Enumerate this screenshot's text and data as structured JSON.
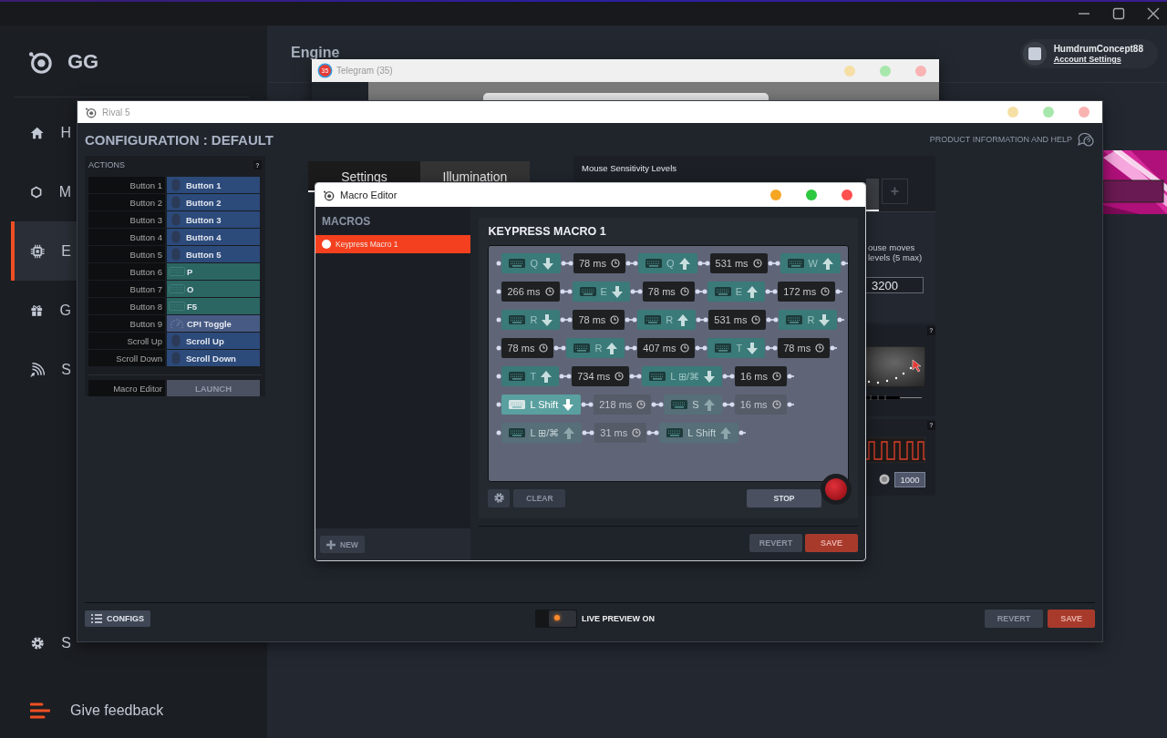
{
  "app": {
    "logo_text": "GG",
    "page_title": "Engine",
    "nav": [
      {
        "label": "H",
        "selected": false
      },
      {
        "label": "M",
        "selected": false
      },
      {
        "label": "E",
        "selected": true
      },
      {
        "label": "G",
        "selected": false
      },
      {
        "label": "S",
        "selected": false
      }
    ],
    "settings": {
      "label": "S"
    },
    "feedback": {
      "label": "Give feedback"
    },
    "account": {
      "username": "HumdrumConcept88",
      "link": "Account Settings"
    }
  },
  "telegram_window": {
    "title": "Telegram (35)",
    "badge": "35",
    "active": false
  },
  "rival_window": {
    "title": "Rival 5",
    "active": false,
    "heading": "CONFIGURATION : DEFAULT",
    "help_link": "PRODUCT INFORMATION AND HELP",
    "actions": {
      "title": "ACTIONS",
      "help": "?",
      "rows": [
        {
          "button": "Button 1",
          "action": "Button 1",
          "kind": "mouse"
        },
        {
          "button": "Button 2",
          "action": "Button 2",
          "kind": "mouse"
        },
        {
          "button": "Button 3",
          "action": "Button 3",
          "kind": "mouse"
        },
        {
          "button": "Button 4",
          "action": "Button 4",
          "kind": "mouse"
        },
        {
          "button": "Button 5",
          "action": "Button 5",
          "kind": "mouse"
        },
        {
          "button": "Button 6",
          "action": "P",
          "kind": "keyboard"
        },
        {
          "button": "Button 7",
          "action": "O",
          "kind": "keyboard"
        },
        {
          "button": "Button 8",
          "action": "F5",
          "kind": "keyboard"
        },
        {
          "button": "Button 9",
          "action": "CPI Toggle",
          "kind": "cpi"
        },
        {
          "button": "Scroll Up",
          "action": "Scroll Up",
          "kind": "mouse"
        },
        {
          "button": "Scroll Down",
          "action": "Scroll Down",
          "kind": "mouse"
        }
      ],
      "macro_editor": {
        "label": "Macro Editor",
        "button": "LAUNCH"
      }
    },
    "tabs": [
      {
        "label": "Settings",
        "selected": true
      },
      {
        "label": "Illumination",
        "selected": false
      }
    ],
    "sensitivity": {
      "title": "Mouse Sensitivity Levels",
      "add": "+",
      "note_lines": [
        "ouse moves",
        "levels (5 max)"
      ],
      "value": "3200"
    },
    "acceleration": {
      "help": "?"
    },
    "polling": {
      "help": "?",
      "value": "1000"
    },
    "footer": {
      "configs": "CONFIGS",
      "live_preview": {
        "label": "LIVE PREVIEW ON",
        "on": true
      },
      "revert": "REVERT",
      "save": "SAVE"
    }
  },
  "macro_window": {
    "title": "Macro Editor",
    "active": true,
    "list_title": "MACROS",
    "macros": [
      {
        "name": "Keypress Macro 1",
        "selected": true
      }
    ],
    "new": "NEW",
    "macro_title": "KEYPRESS MACRO 1",
    "rows": [
      {
        "steps": [
          {
            "kind": "key",
            "key": "Q",
            "key_down": true,
            "current": false,
            "pending": false
          },
          {
            "kind": "delay",
            "label": "78 ms",
            "current": false,
            "pending": false
          },
          {
            "kind": "key",
            "key": "Q",
            "key_down": false,
            "current": false,
            "pending": false
          },
          {
            "kind": "delay",
            "label": "531 ms",
            "current": false,
            "pending": false
          },
          {
            "kind": "key",
            "key": "W",
            "key_down": false,
            "current": false,
            "pending": false
          }
        ]
      },
      {
        "steps": [
          {
            "kind": "delay",
            "label": "266 ms",
            "current": false,
            "pending": false
          },
          {
            "kind": "key",
            "key": "E",
            "key_down": true,
            "current": false,
            "pending": false
          },
          {
            "kind": "delay",
            "label": "78 ms",
            "current": false,
            "pending": false
          },
          {
            "kind": "key",
            "key": "E",
            "key_down": false,
            "current": false,
            "pending": false
          },
          {
            "kind": "delay",
            "label": "172 ms",
            "current": false,
            "pending": false
          }
        ]
      },
      {
        "steps": [
          {
            "kind": "key",
            "key": "R",
            "key_down": true,
            "current": false,
            "pending": false
          },
          {
            "kind": "delay",
            "label": "78 ms",
            "current": false,
            "pending": false
          },
          {
            "kind": "key",
            "key": "R",
            "key_down": false,
            "current": false,
            "pending": false
          },
          {
            "kind": "delay",
            "label": "531 ms",
            "current": false,
            "pending": false
          },
          {
            "kind": "key",
            "key": "R",
            "key_down": true,
            "current": false,
            "pending": false
          }
        ]
      },
      {
        "steps": [
          {
            "kind": "delay",
            "label": "78 ms",
            "current": false,
            "pending": false
          },
          {
            "kind": "key",
            "key": "R",
            "key_down": false,
            "current": false,
            "pending": false
          },
          {
            "kind": "delay",
            "label": "407 ms",
            "current": false,
            "pending": false
          },
          {
            "kind": "key",
            "key": "T",
            "key_down": true,
            "current": false,
            "pending": false
          },
          {
            "kind": "delay",
            "label": "78 ms",
            "current": false,
            "pending": false
          }
        ]
      },
      {
        "steps": [
          {
            "kind": "key",
            "key": "T",
            "key_down": false,
            "current": false,
            "pending": false
          },
          {
            "kind": "delay",
            "label": "734 ms",
            "current": false,
            "pending": false
          },
          {
            "kind": "key",
            "key": "L ⊞/⌘",
            "key_down": true,
            "current": false,
            "pending": false
          },
          {
            "kind": "delay",
            "label": "16 ms",
            "current": false,
            "pending": false
          }
        ]
      },
      {
        "steps": [
          {
            "kind": "key",
            "key": "L Shift",
            "key_down": true,
            "current": true,
            "pending": false
          },
          {
            "kind": "delay",
            "label": "218 ms",
            "current": false,
            "pending": true
          },
          {
            "kind": "key",
            "key": "S",
            "key_down": false,
            "current": false,
            "pending": true
          },
          {
            "kind": "delay",
            "label": "16 ms",
            "current": false,
            "pending": true
          }
        ]
      },
      {
        "steps": [
          {
            "kind": "key",
            "key": "L ⊞/⌘",
            "key_down": false,
            "current": false,
            "pending": true
          },
          {
            "kind": "delay",
            "label": "31 ms",
            "current": false,
            "pending": true
          },
          {
            "kind": "key",
            "key": "L Shift",
            "key_down": false,
            "current": false,
            "pending": true
          }
        ]
      }
    ],
    "clear": "CLEAR",
    "stop": "STOP",
    "recording": true,
    "revert": "REVERT",
    "save": "SAVE"
  }
}
